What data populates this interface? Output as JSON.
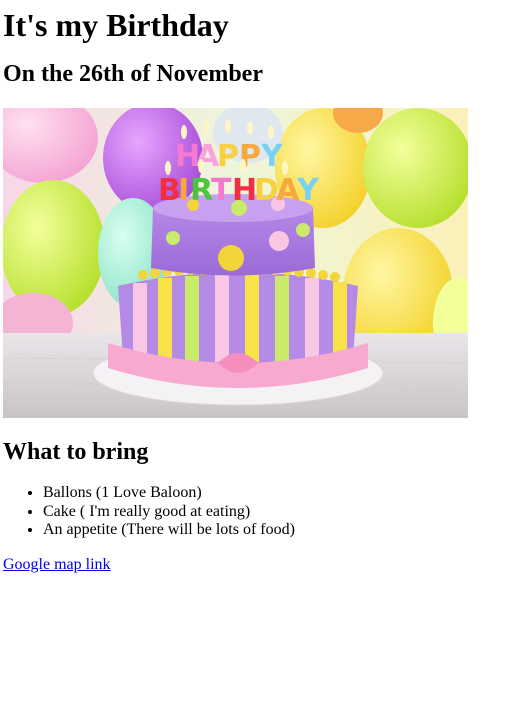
{
  "page": {
    "title": "It's my Birthday",
    "date_heading": "On the 26th of November",
    "image": {
      "alt": "Birthday cake with candles",
      "candles_top": "HAPPY",
      "candles_bottom": "BIRTHDAY"
    },
    "bring_heading": "What to bring",
    "items": [
      "Ballons (1 Love Baloon)",
      "Cake ( I'm really good at eating)",
      "An appetite (There will be lots of food)"
    ],
    "map_link": "Google map link"
  },
  "colors": {
    "link": "#0000ee",
    "text": "#000000",
    "background": "#ffffff"
  }
}
